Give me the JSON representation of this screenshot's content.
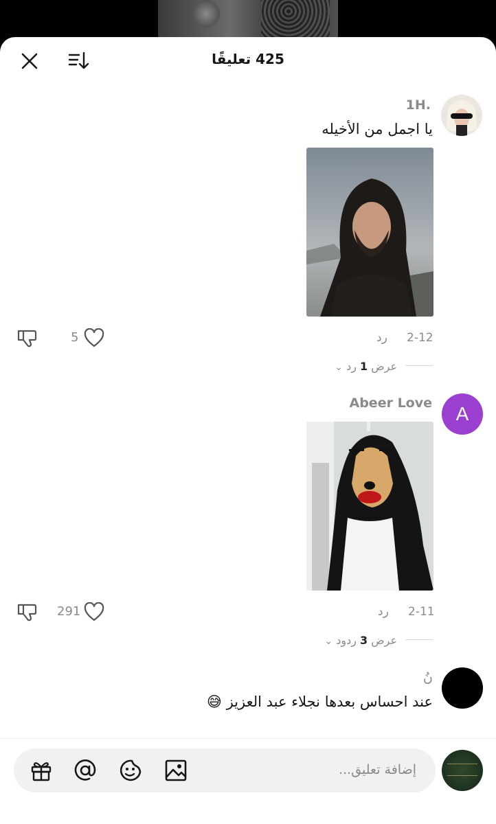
{
  "header": {
    "title": "425 تعليقًا",
    "close_icon": "close-icon",
    "sort_icon": "sort-icon"
  },
  "comments": [
    {
      "username": "1H.",
      "text": "يا اجمل من الأخيله",
      "attachment": "photo of long-haired bearded man",
      "date": "2-12",
      "reply_label": "رد",
      "likes": "5",
      "view_replies_prefix": "عرض",
      "view_replies_count": "1",
      "view_replies_suffix": "رد"
    },
    {
      "username": "Abeer Love",
      "avatar_letter": "A",
      "avatar_color": "#9b3fd0",
      "attachment": "dog in long black wig with lipstick",
      "date": "2-11",
      "reply_label": "رد",
      "likes": "291",
      "view_replies_prefix": "عرض",
      "view_replies_count": "3",
      "view_replies_suffix": "ردود"
    },
    {
      "username": "نُ",
      "text": "عند احساس بعدها نجلاء عبد العزيز 😅"
    }
  ],
  "composer": {
    "placeholder": "إضافة تعليق...",
    "icons": [
      "gift-icon",
      "mention-icon",
      "emoji-icon",
      "image-icon"
    ]
  }
}
